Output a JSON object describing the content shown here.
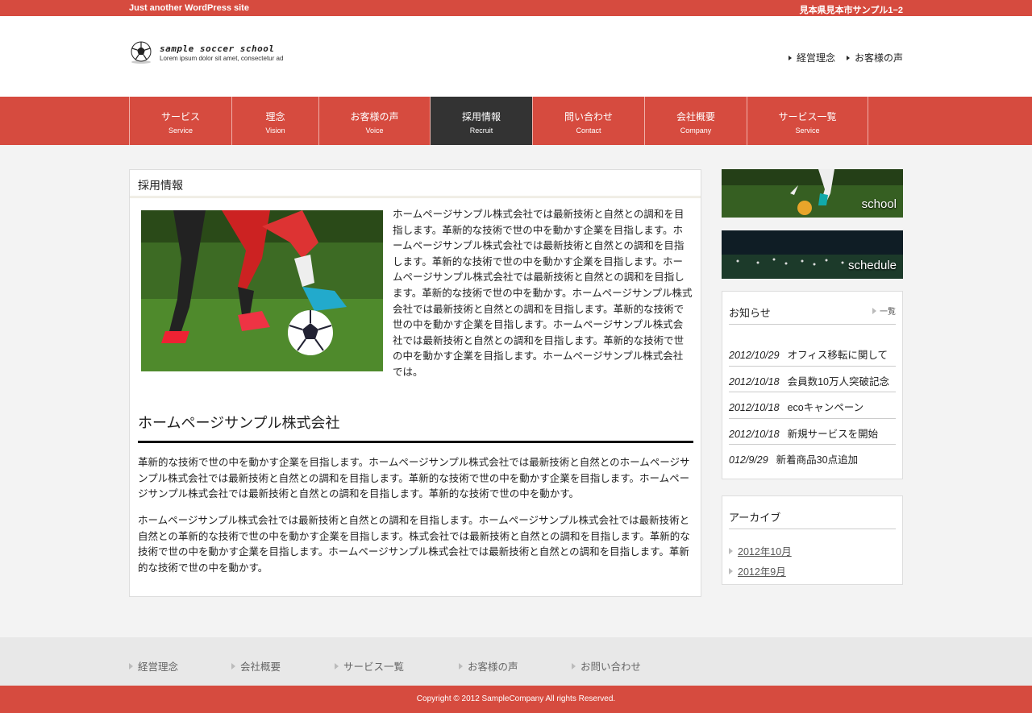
{
  "topbar": {
    "tagline": "Just another WordPress site",
    "address": "見本県見本市サンプル1−2"
  },
  "header": {
    "logo_name": "sample soccer school",
    "logo_sub": "Lorem ipsum dolor sit amet, consectetur ad",
    "links": [
      "経営理念",
      "お客様の声"
    ]
  },
  "nav": [
    {
      "jp": "サービス",
      "en": "Service"
    },
    {
      "jp": "理念",
      "en": "Vision"
    },
    {
      "jp": "お客様の声",
      "en": "Voice"
    },
    {
      "jp": "採用情報",
      "en": "Recruit"
    },
    {
      "jp": "問い合わせ",
      "en": "Contact"
    },
    {
      "jp": "会社概要",
      "en": "Company"
    },
    {
      "jp": "サービス一覧",
      "en": "Service"
    }
  ],
  "main": {
    "page_title": "採用情報",
    "intro": "ホームページサンプル株式会社では最新技術と自然との調和を目指します。革新的な技術で世の中を動かす企業を目指します。ホームページサンプル株式会社では最新技術と自然との調和を目指します。革新的な技術で世の中を動かす企業を目指します。ホームページサンプル株式会社では最新技術と自然との調和を目指します。革新的な技術で世の中を動かす。ホームページサンプル株式会社では最新技術と自然との調和を目指します。革新的な技術で世の中を動かす企業を目指します。ホームページサンプル株式会社では最新技術と自然との調和を目指します。革新的な技術で世の中を動かす企業を目指します。ホームページサンプル株式会社では。",
    "heading": "ホームページサンプル株式会社",
    "para1": "革新的な技術で世の中を動かす企業を目指します。ホームページサンプル株式会社では最新技術と自然とのホームページサンプル株式会社では最新技術と自然との調和を目指します。革新的な技術で世の中を動かす企業を目指します。ホームページサンプル株式会社では最新技術と自然との調和を目指します。革新的な技術で世の中を動かす。",
    "para2": "ホームページサンプル株式会社では最新技術と自然との調和を目指します。ホームページサンプル株式会社では最新技術と自然との革新的な技術で世の中を動かす企業を目指します。株式会社では最新技術と自然との調和を目指します。革新的な技術で世の中を動かす企業を目指します。ホームページサンプル株式会社では最新技術と自然との調和を目指します。革新的な技術で世の中を動かす。"
  },
  "sidebar": {
    "banner_school": "school",
    "banner_schedule": "schedule",
    "news_title": "お知らせ",
    "news_more": "一覧",
    "news": [
      {
        "date": "2012/10/29",
        "title": "オフィス移転に関して"
      },
      {
        "date": "2012/10/18",
        "title": "会員数10万人突破記念"
      },
      {
        "date": "2012/10/18",
        "title": "ecoキャンペーン"
      },
      {
        "date": "2012/10/18",
        "title": "新規サービスを開始"
      },
      {
        "date": "012/9/29",
        "title": "新着商品30点追加"
      }
    ],
    "archive_title": "アーカイブ",
    "archive": [
      "2012年10月",
      "2012年9月"
    ]
  },
  "footer": {
    "links": [
      "経営理念",
      "会社概要",
      "サービス一覧",
      "お客様の声",
      "お問い合わせ"
    ],
    "copyright": "Copyright © 2012 SampleCompany All rights Reserved."
  },
  "colors": {
    "accent": "#d64b3f",
    "active_nav": "#333333"
  }
}
